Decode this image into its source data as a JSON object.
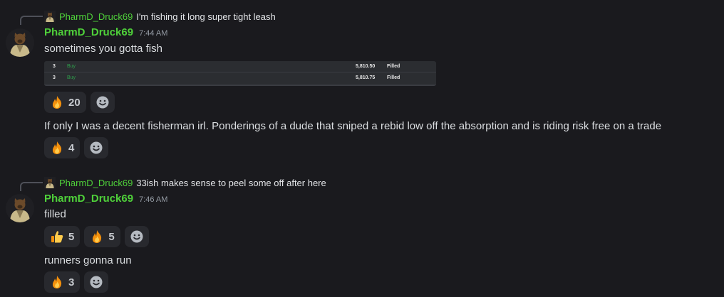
{
  "messages": [
    {
      "reply": {
        "username": "PharmD_Druck69",
        "text": "I'm fishing it long super tight leash"
      },
      "username": "PharmD_Druck69",
      "timestamp": "7:44 AM",
      "body": [
        {
          "text": "sometimes you gotta fish",
          "reactions": [
            {
              "emoji": "fire",
              "count": "20"
            }
          ]
        },
        {
          "text": "If only I was a decent fisherman irl. Ponderings of a dude that sniped a rebid low off the absorption and is riding risk free on a trade",
          "reactions": [
            {
              "emoji": "fire",
              "count": "4"
            }
          ]
        }
      ],
      "trade_table": [
        {
          "qty": "3",
          "side": "Buy",
          "price": "5,810.50",
          "status": "Filled"
        },
        {
          "qty": "3",
          "side": "Buy",
          "price": "5,810.75",
          "status": "Filled"
        }
      ]
    },
    {
      "reply": {
        "username": "PharmD_Druck69",
        "text": "33ish makes sense to peel some off after here"
      },
      "username": "PharmD_Druck69",
      "timestamp": "7:46 AM",
      "body": [
        {
          "text": "filled",
          "reactions": [
            {
              "emoji": "thumbs-up",
              "count": "5"
            },
            {
              "emoji": "fire",
              "count": "5"
            }
          ]
        },
        {
          "text": "runners gonna run",
          "reactions": [
            {
              "emoji": "fire",
              "count": "3"
            }
          ]
        }
      ]
    }
  ],
  "colors": {
    "username": "#4fd13a",
    "background": "#1a1a1e",
    "reaction_bg": "#28292e",
    "buy": "#2e9e4b"
  }
}
